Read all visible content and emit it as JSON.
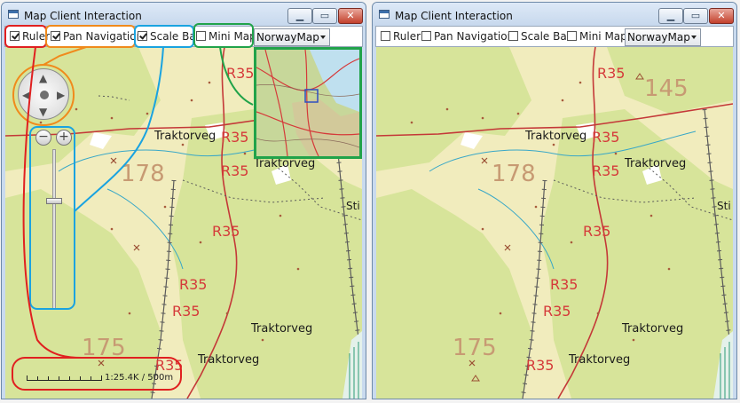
{
  "left": {
    "title": "Map Client Interaction",
    "toolbar": {
      "ruler": {
        "label": "Ruler",
        "checked": true
      },
      "pan": {
        "label": "Pan Navigation",
        "checked": true
      },
      "scale": {
        "label": "Scale Bar",
        "checked": true
      },
      "mini": {
        "label": "Mini Map",
        "checked": false
      },
      "map_select": "NorwayMap"
    },
    "labels": {
      "r35_a": "R35",
      "r35_b": "R35",
      "r35_c": "R35",
      "r35_d": "R35",
      "r35_e": "R35",
      "r35_f": "R35",
      "r35_g": "R35",
      "traktorveg_a": "Traktorveg",
      "traktorveg_b": "Traktorveg",
      "traktorveg_c": "Traktorveg",
      "traktorveg_d": "Traktorveg",
      "n178": "178",
      "n175": "175",
      "sti": "Sti"
    },
    "scale_text": "1:25.4K / 500m",
    "zoom_level": 0.72
  },
  "right": {
    "title": "Map Client Interaction",
    "toolbar": {
      "ruler": {
        "label": "Ruler",
        "checked": false
      },
      "pan": {
        "label": "Pan Navigation",
        "checked": false
      },
      "scale": {
        "label": "Scale Bar",
        "checked": false
      },
      "mini": {
        "label": "Mini Map",
        "checked": false
      },
      "map_select": "NorwayMap"
    },
    "labels": {
      "r35_a": "R35",
      "r35_b": "R35",
      "r35_c": "R35",
      "r35_d": "R35",
      "r35_e": "R35",
      "r35_f": "R35",
      "r35_g": "R35",
      "traktorveg_a": "Traktorveg",
      "traktorveg_b": "Traktorveg",
      "traktorveg_c": "Traktorveg",
      "traktorveg_d": "Traktorveg",
      "n145": "145",
      "n178": "178",
      "n175": "175",
      "sti": "Sti"
    }
  },
  "window_buttons": {
    "minimize": "▁",
    "maximize": "▭",
    "close": "✕"
  },
  "colors": {
    "annotation_ruler": "#e02020",
    "annotation_pan": "#f08a1c",
    "annotation_scale": "#1aa3e0",
    "annotation_minimap": "#21a34a",
    "road": "#d53a3a",
    "forest": "#d7e49a"
  }
}
